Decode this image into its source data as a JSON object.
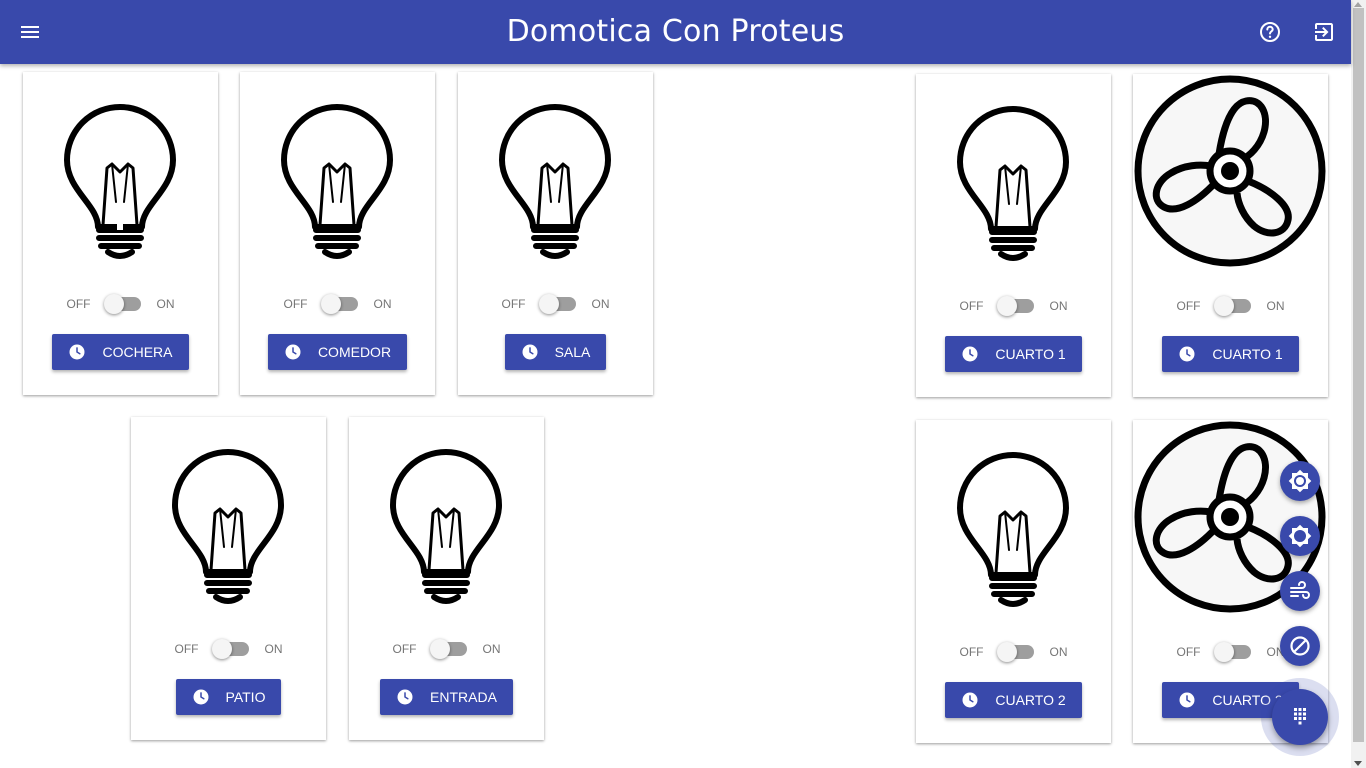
{
  "header": {
    "title": "Domotica Con Proteus",
    "menu_icon": "menu-icon",
    "help_icon": "help-circle-icon",
    "exit_icon": "exit-to-app-icon"
  },
  "switch_labels": {
    "off": "OFF",
    "on": "ON"
  },
  "cards": [
    {
      "type": "bulb",
      "button_label": "COCHERA",
      "on": false
    },
    {
      "type": "bulb",
      "button_label": "COMEDOR",
      "on": false
    },
    {
      "type": "bulb",
      "button_label": "SALA",
      "on": false
    },
    {
      "type": "bulb",
      "button_label": "CUARTO 1",
      "on": false
    },
    {
      "type": "fan",
      "button_label": "CUARTO 1",
      "on": false
    },
    {
      "type": "bulb",
      "button_label": "PATIO",
      "on": false
    },
    {
      "type": "bulb",
      "button_label": "ENTRADA",
      "on": false
    },
    {
      "type": "bulb",
      "button_label": "CUARTO 2",
      "on": false
    },
    {
      "type": "fan",
      "button_label": "CUARTO 2",
      "on": false
    }
  ],
  "fab_actions": [
    {
      "icon": "brightness-high-icon"
    },
    {
      "icon": "brightness-low-icon"
    },
    {
      "icon": "wind-icon"
    },
    {
      "icon": "block-icon"
    }
  ],
  "fab_main": {
    "icon": "dialpad-icon"
  },
  "colors": {
    "primary": "#3949ab",
    "switch_track": "#9e9e9e",
    "switch_thumb": "#f5f5f5"
  }
}
